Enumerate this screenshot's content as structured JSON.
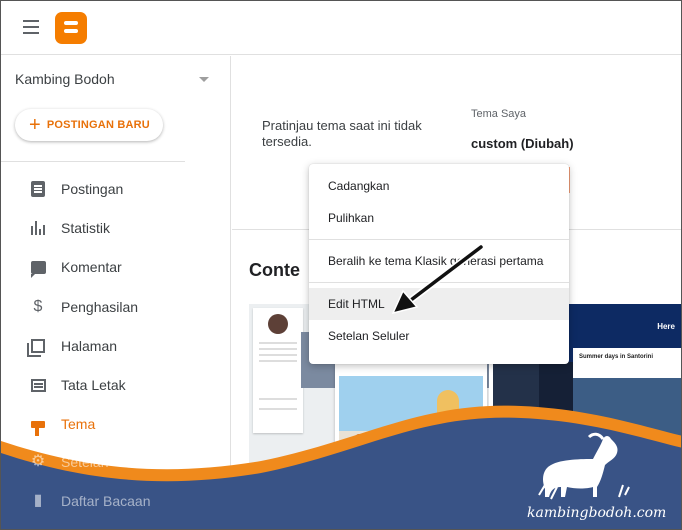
{
  "topbar": {
    "menu_icon": "hamburger-menu-icon",
    "logo_icon": "blogger-logo-icon"
  },
  "sidebar": {
    "blog_name": "Kambing Bodoh",
    "new_post_label": "POSTINGAN BARU",
    "items": [
      {
        "label": "Postingan",
        "icon": "posts-icon"
      },
      {
        "label": "Statistik",
        "icon": "stats-icon"
      },
      {
        "label": "Komentar",
        "icon": "comment-icon"
      },
      {
        "label": "Penghasilan",
        "icon": "dollar-icon"
      },
      {
        "label": "Halaman",
        "icon": "pages-icon"
      },
      {
        "label": "Tata Letak",
        "icon": "layout-icon"
      },
      {
        "label": "Tema",
        "icon": "paint-roller-icon",
        "active": true
      },
      {
        "label": "Setelan",
        "icon": "gear-icon"
      },
      {
        "label": "Daftar Bacaan",
        "icon": "bookmark-icon"
      }
    ]
  },
  "main": {
    "preview_message": "Pratinjau tema saat ini tidak tersedia.",
    "my_theme_label": "Tema Saya",
    "my_theme_value": "custom (Diubah)",
    "section_title": "Conte",
    "thumb2_here": "Here",
    "thumb2_post_title": "Summer days in Santorini"
  },
  "menu": {
    "items": [
      "Cadangkan",
      "Pulihkan",
      "Beralih ke tema Klasik generasi pertama",
      "Edit HTML",
      "Setelan Seluler"
    ]
  },
  "watermark": {
    "text": "kambingbodoh.com"
  },
  "colors": {
    "accent": "#e8710a",
    "wave_blue": "#2b4f8e",
    "wave_orange": "#f08a1c"
  }
}
